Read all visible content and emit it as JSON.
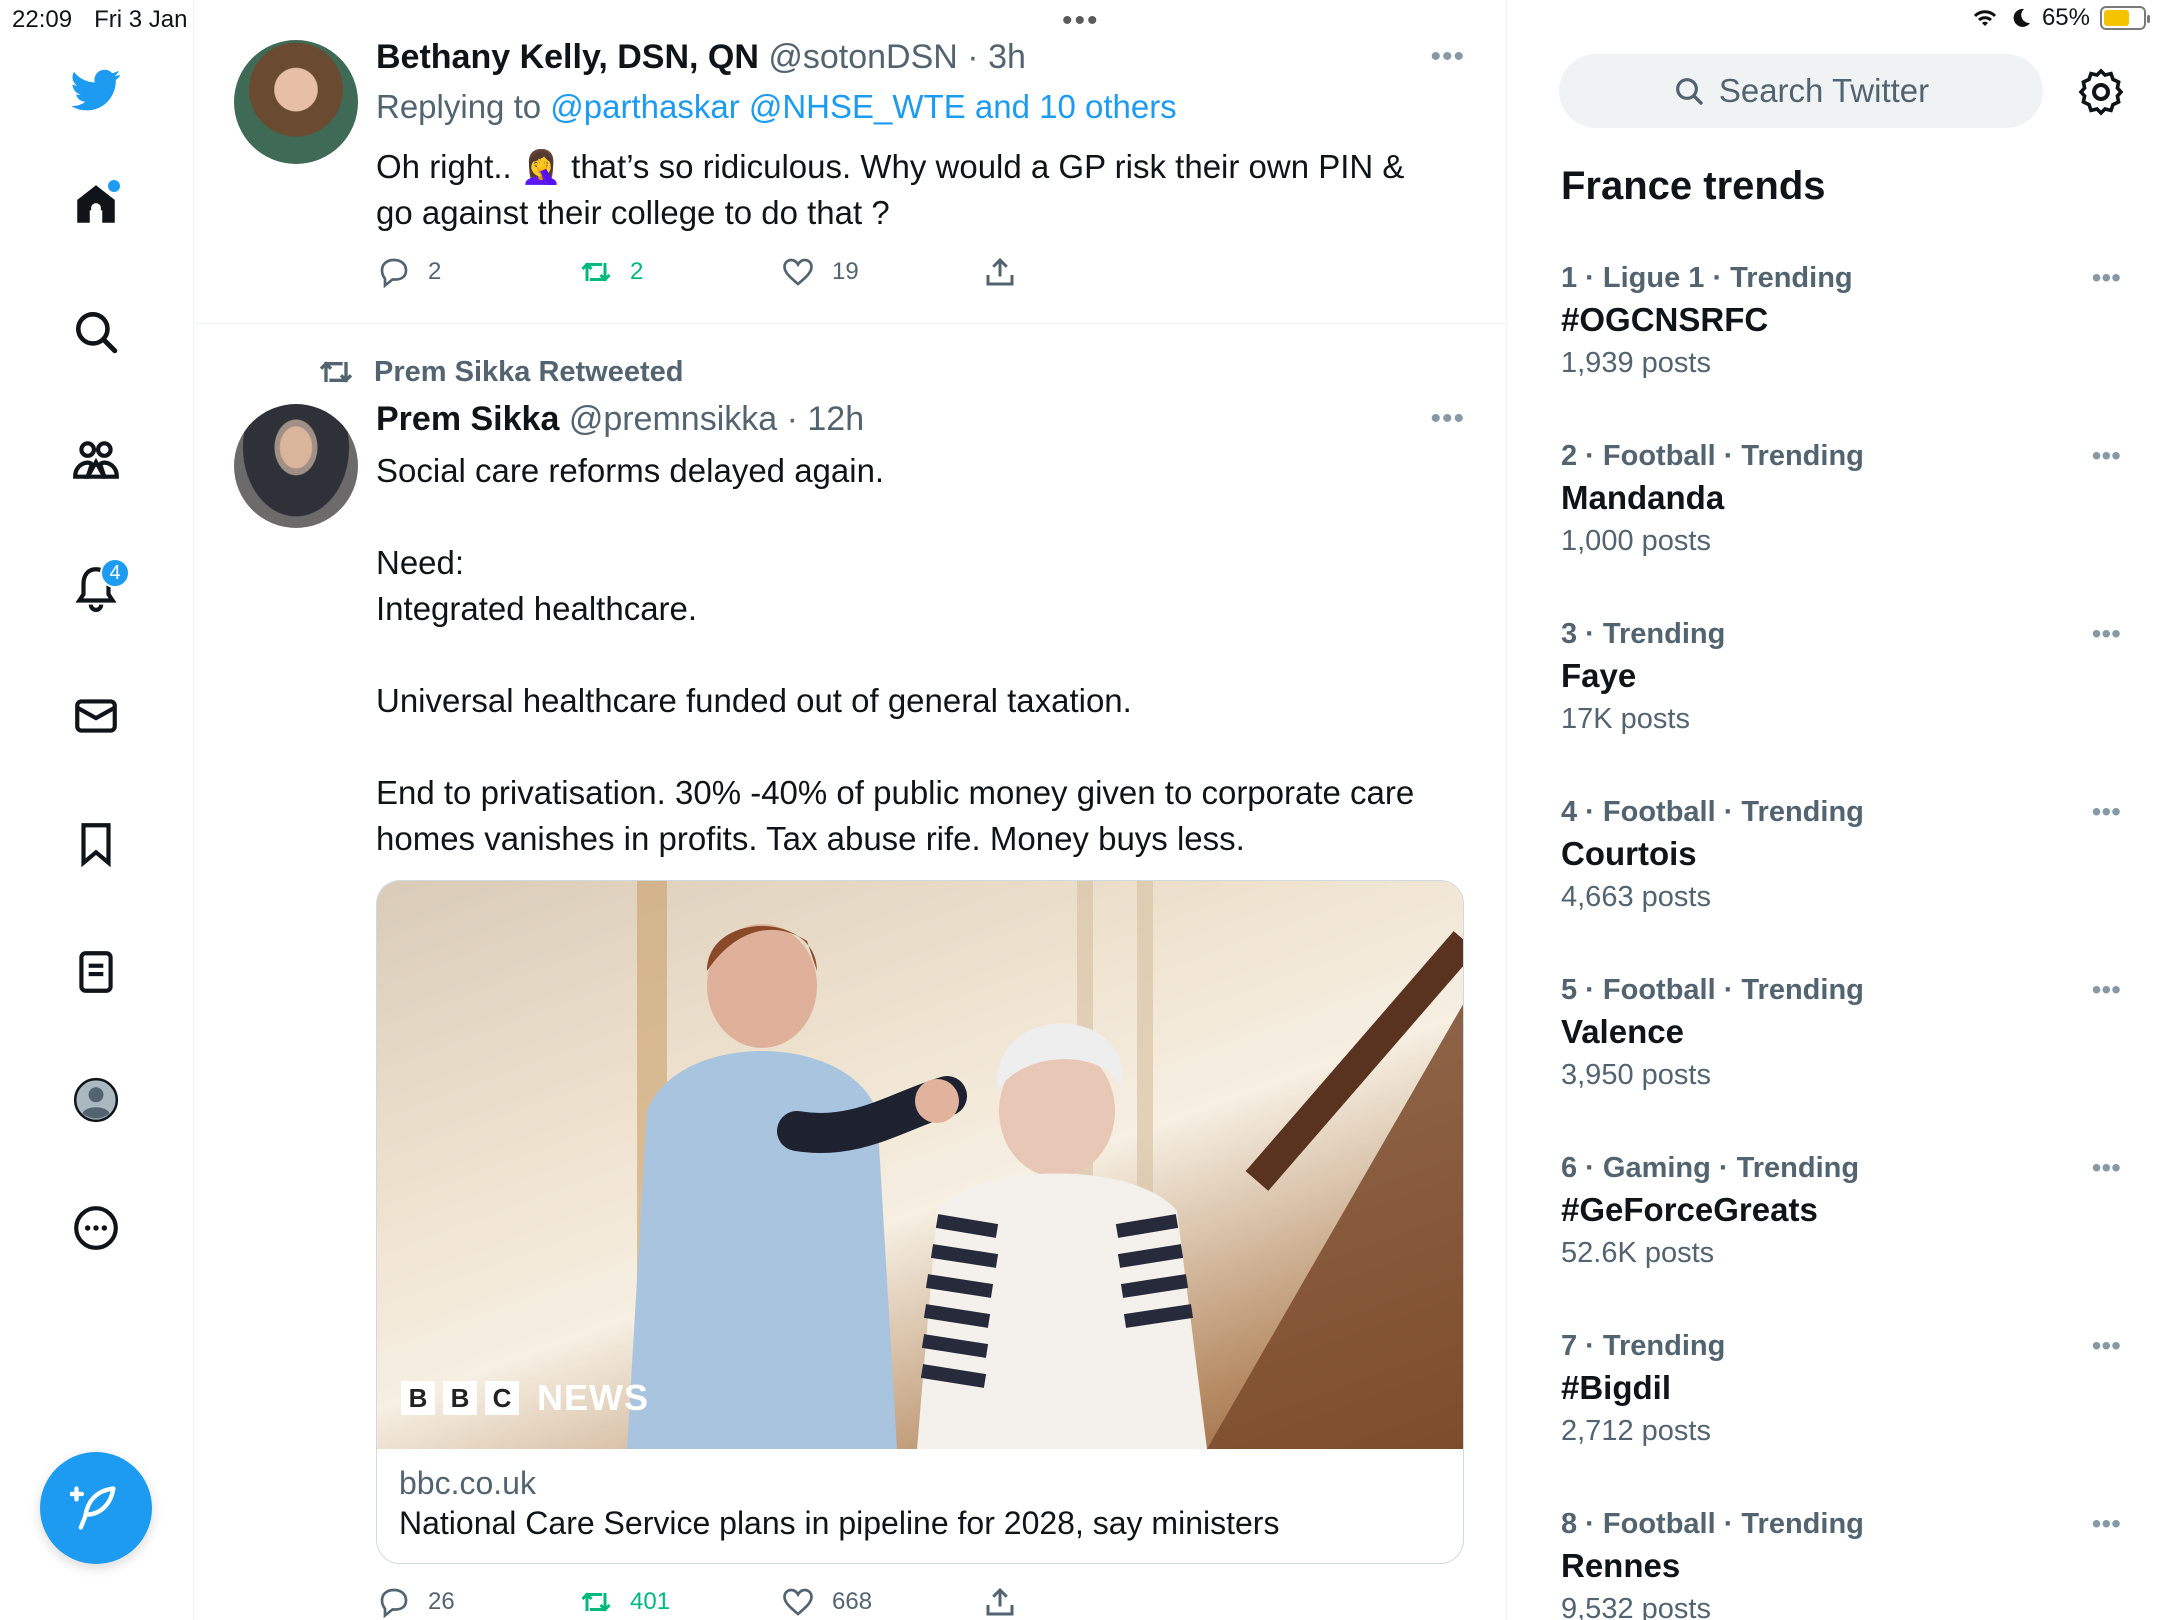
{
  "status_bar": {
    "time": "22:09",
    "date": "Fri 3 Jan",
    "battery": "65%",
    "battery_level": 0.65
  },
  "nav": {
    "items": [
      "twitter-logo",
      "home-icon",
      "search-icon",
      "communities-icon",
      "notifications-icon",
      "messages-icon",
      "bookmarks-icon",
      "lists-icon",
      "profile-icon",
      "more-icon"
    ],
    "notifications_badge": "4"
  },
  "feed": {
    "tweet1": {
      "name": "Bethany Kelly, DSN, QN",
      "handle": "@sotonDSN",
      "time": "· 3h",
      "replying_prefix": "Replying to ",
      "replying_to": "@parthaskar @NHSE_WTE and 10 others",
      "text": "Oh right.. 🤦‍♀️ that’s so ridiculous. Why would a GP risk their own PIN &\ngo against their college to do that ?",
      "replies": "2",
      "retweets": "2",
      "likes": "19"
    },
    "retweet_label": "Prem Sikka Retweeted",
    "tweet2": {
      "name": "Prem Sikka",
      "handle": "@premnsikka",
      "time": "· 12h",
      "text": "Social care reforms delayed again.\n\nNeed:\nIntegrated healthcare.\n\nUniversal healthcare funded out of general taxation.\n\nEnd to privatisation. 30% -40% of public money given to corporate care\nhomes vanishes in profits. Tax abuse rife. Money buys less.",
      "card_logo_b1": "B",
      "card_logo_b2": "B",
      "card_logo_c": "C",
      "card_logo_news": "NEWS",
      "card_domain": "bbc.co.uk",
      "card_title": "National Care Service plans in pipeline for 2028, say ministers",
      "replies": "26",
      "retweets": "401",
      "likes": "668"
    }
  },
  "sidebar": {
    "search_placeholder": "Search Twitter",
    "trends_title": "France trends",
    "trends": [
      {
        "meta": "1 · Ligue 1 · Trending",
        "name": "#OGCNSRFC",
        "count": "1,939 posts"
      },
      {
        "meta": "2 · Football · Trending",
        "name": "Mandanda",
        "count": "1,000 posts"
      },
      {
        "meta": "3 · Trending",
        "name": "Faye",
        "count": "17K posts"
      },
      {
        "meta": "4 · Football · Trending",
        "name": "Courtois",
        "count": "4,663 posts"
      },
      {
        "meta": "5 · Football · Trending",
        "name": "Valence",
        "count": "3,950 posts"
      },
      {
        "meta": "6 · Gaming · Trending",
        "name": "#GeForceGreats",
        "count": "52.6K posts"
      },
      {
        "meta": "7 · Trending",
        "name": "#Bigdil",
        "count": "2,712 posts"
      },
      {
        "meta": "8 · Football · Trending",
        "name": "Rennes",
        "count": "9,532 posts"
      }
    ]
  },
  "colors": {
    "accent": "#1d9bf0",
    "retweet_green": "#00ba7c",
    "muted": "#536471"
  }
}
